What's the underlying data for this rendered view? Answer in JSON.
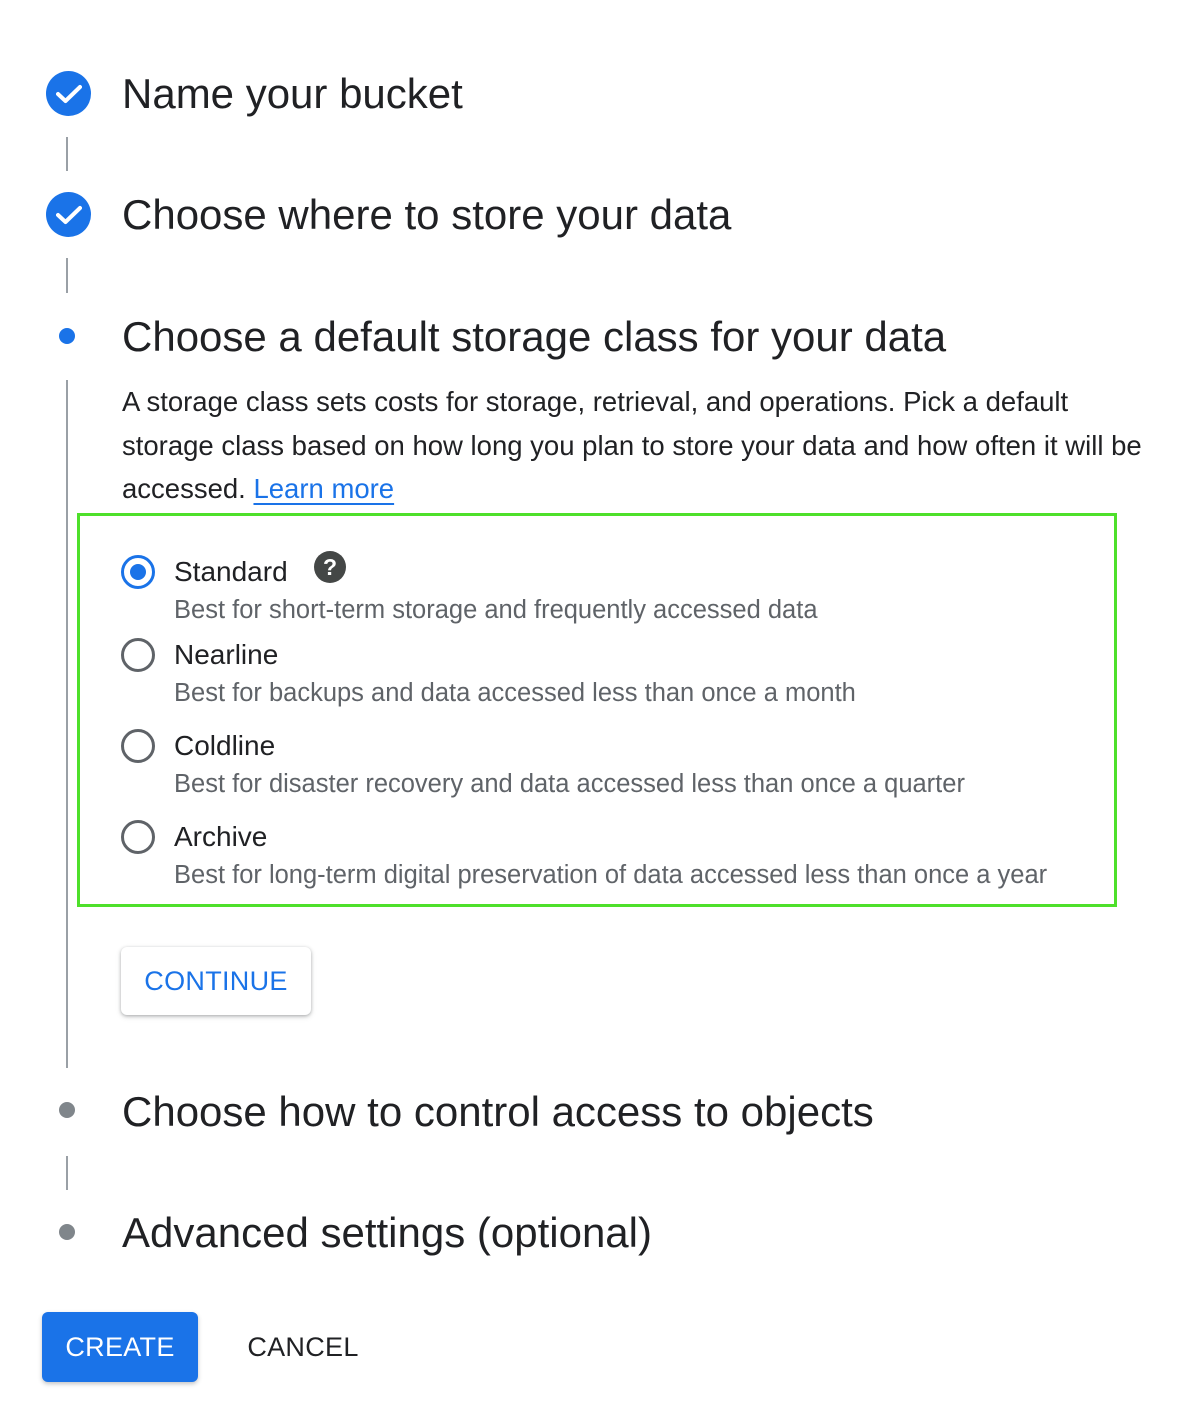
{
  "steps": [
    {
      "title": "Name your bucket",
      "state": "completed"
    },
    {
      "title": "Choose where to store your data",
      "state": "completed"
    },
    {
      "title": "Choose a default storage class for your data",
      "state": "active"
    },
    {
      "title": "Choose how to control access to objects",
      "state": "pending"
    },
    {
      "title": "Advanced settings (optional)",
      "state": "pending"
    }
  ],
  "storage_class": {
    "description": "A storage class sets costs for storage, retrieval, and operations. Pick a default storage class based on how long you plan to store your data and how often it will be accessed.",
    "learn_more": "Learn more",
    "help_icon": "?",
    "selected": "Standard",
    "options": [
      {
        "label": "Standard",
        "help": "Best for short-term storage and frequently accessed data"
      },
      {
        "label": "Nearline",
        "help": "Best for backups and data accessed less than once a month"
      },
      {
        "label": "Coldline",
        "help": "Best for disaster recovery and data accessed less than once a quarter"
      },
      {
        "label": "Archive",
        "help": "Best for long-term digital preservation of data accessed less than once a year"
      }
    ],
    "continue_label": "CONTINUE"
  },
  "actions": {
    "create_label": "CREATE",
    "cancel_label": "CANCEL"
  },
  "colors": {
    "primary": "#1a73e8",
    "highlight_border": "#4ee02a",
    "pending_dot": "#80868b"
  },
  "icons": {
    "completed": "check-icon",
    "help": "help-icon"
  }
}
